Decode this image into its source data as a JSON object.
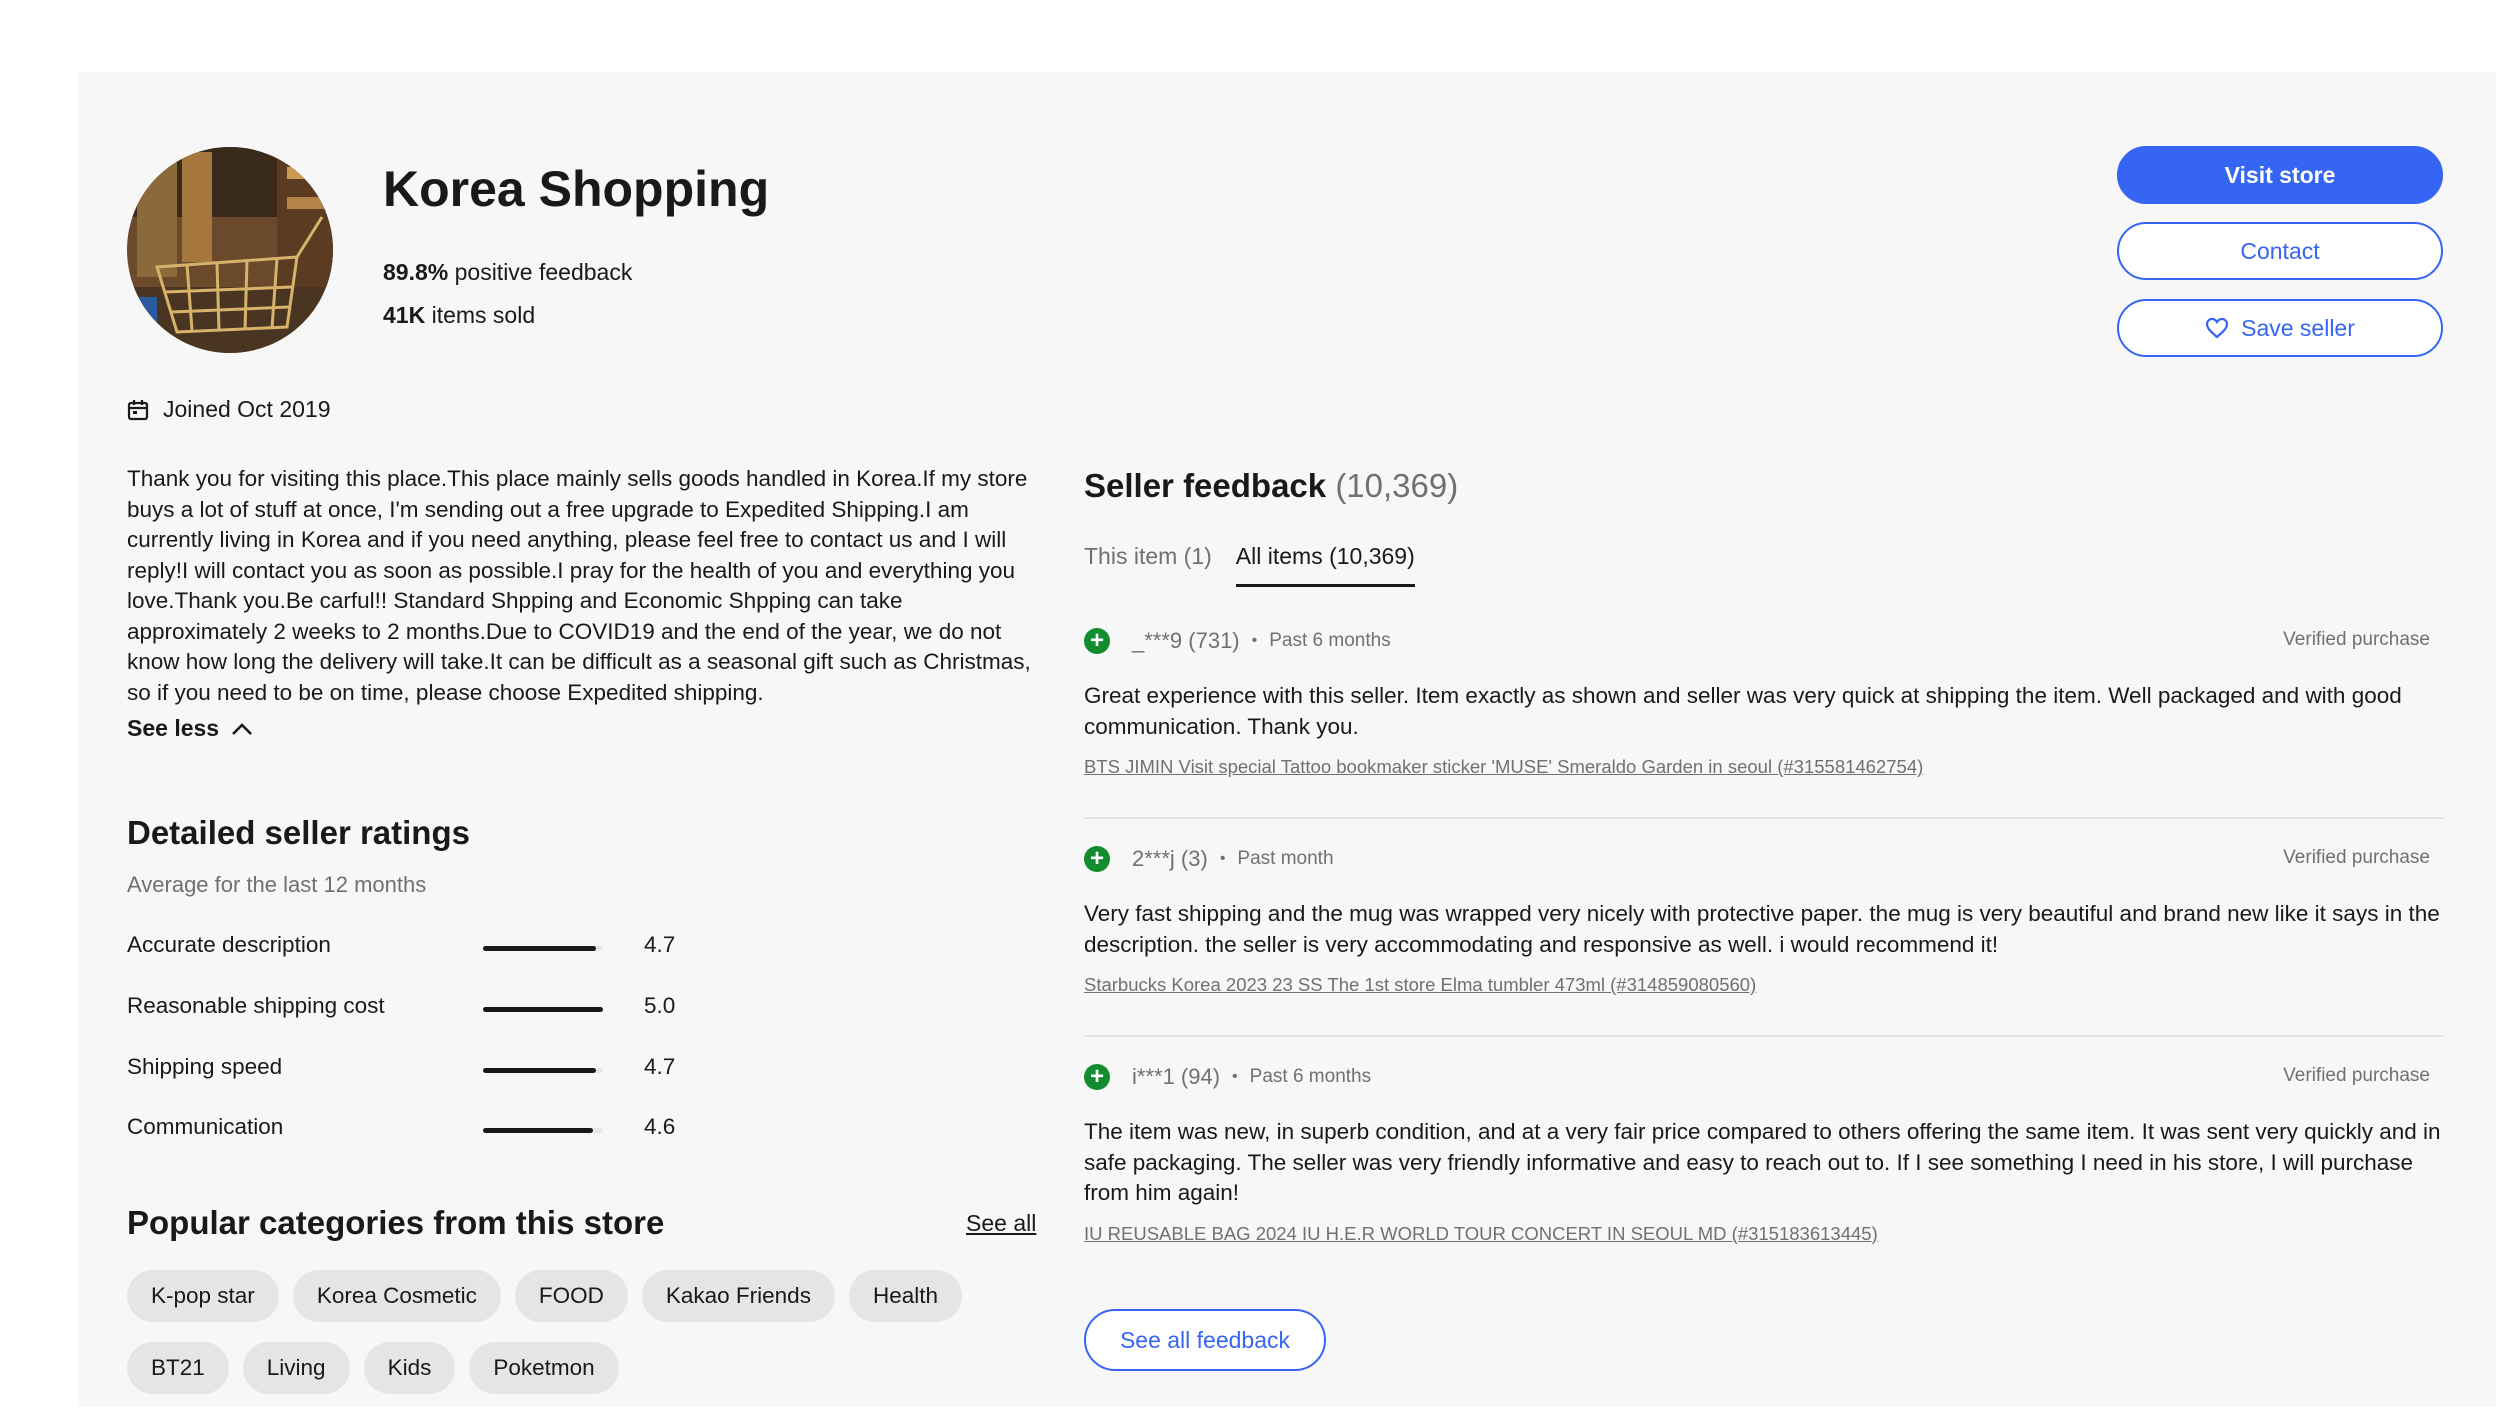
{
  "store": {
    "name": "Korea Shopping",
    "positive_feedback_value": "89.8%",
    "positive_feedback_label": "positive feedback",
    "items_sold_value": "41K",
    "items_sold_label": "items sold",
    "joined": "Joined Oct 2019",
    "about": "Thank you for visiting this place.This place mainly sells goods handled in Korea.If my store buys a lot of stuff at once, I'm sending out a free upgrade to Expedited Shipping.I am currently living in Korea and if you need anything, please feel free to contact us and I will reply!I will contact you as soon as possible.I pray for the health of you and everything you love.Thank you.Be carful!! Standard Shpping and Economic Shpping can take approximately 2 weeks to 2 months.Due to COVID19 and the end of the year, we do not know how long the delivery will take.It can be difficult as a seasonal gift such as Christmas, so if you need to be on time, please choose Expedited shipping.",
    "see_less": "See less"
  },
  "actions": {
    "visit_store": "Visit store",
    "contact": "Contact",
    "save_seller": "Save seller"
  },
  "ratings": {
    "title": "Detailed seller ratings",
    "subtitle": "Average for the last 12 months",
    "max": 5,
    "items": [
      {
        "label": "Accurate description",
        "value": "4.7",
        "score": 4.7
      },
      {
        "label": "Reasonable shipping cost",
        "value": "5.0",
        "score": 5.0
      },
      {
        "label": "Shipping speed",
        "value": "4.7",
        "score": 4.7
      },
      {
        "label": "Communication",
        "value": "4.6",
        "score": 4.6
      }
    ]
  },
  "categories": {
    "title": "Popular categories from this store",
    "see_all": "See all",
    "items": [
      "K-pop star",
      "Korea Cosmetic",
      "FOOD",
      "Kakao Friends",
      "Health",
      "BT21",
      "Living",
      "Kids",
      "Poketmon"
    ]
  },
  "feedback": {
    "title": "Seller feedback",
    "count": "(10,369)",
    "tabs": [
      {
        "label": "This item (1)",
        "active": false
      },
      {
        "label": "All items (10,369)",
        "active": true
      }
    ],
    "reviews": [
      {
        "user": "_***9 (731)",
        "when": "Past 6 months",
        "verified": "Verified purchase",
        "text": "Great experience with this seller. Item exactly as shown and seller was very quick at shipping the item. Well packaged and with good communication. Thank you.",
        "item": "BTS JIMIN Visit special Tattoo bookmaker sticker 'MUSE' Smeraldo Garden in seoul (#315581462754)"
      },
      {
        "user": "2***j (3)",
        "when": "Past month",
        "verified": "Verified purchase",
        "text": "Very fast shipping and the mug was wrapped very nicely with protective paper. the mug is very beautiful and brand new like it says in the description. the seller is very accommodating and responsive as well. i would recommend it!",
        "item": "Starbucks Korea 2023 23 SS The 1st store Elma tumbler 473ml (#314859080560)"
      },
      {
        "user": "i***1 (94)",
        "when": "Past 6 months",
        "verified": "Verified purchase",
        "text": "The item was new, in superb condition, and at a very fair price compared to others offering the same item. It was sent very quickly and in safe packaging. The seller was very friendly informative and easy to reach out to. If I see something I need in his store, I will purchase from him again!",
        "item": "IU REUSABLE BAG 2024 IU H.E.R WORLD TOUR CONCERT IN SEOUL MD (#315183613445)"
      }
    ],
    "see_all": "See all feedback"
  },
  "colors": {
    "accent": "#3665f3",
    "positive": "#118c2f",
    "panel_bg": "#f7f7f7",
    "chip_bg": "#e5e5e5"
  }
}
